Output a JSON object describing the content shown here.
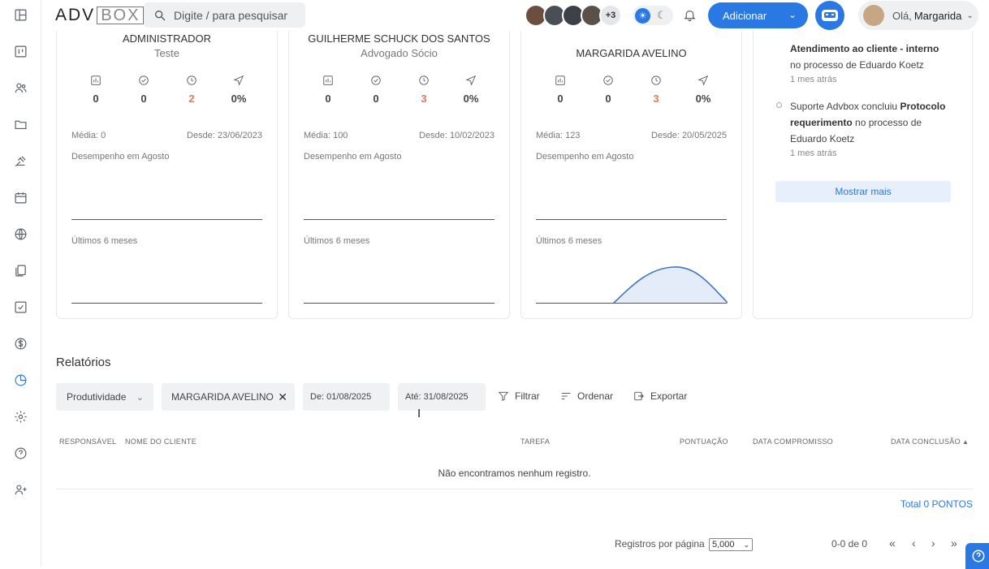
{
  "search": {
    "placeholder": "Digite / para pesquisar"
  },
  "header": {
    "avatars_more": "+3",
    "add_label": "Adicionar",
    "greeting": "Olá,",
    "user_name": "Margarida"
  },
  "cards": [
    {
      "name": "ADMINISTRADOR",
      "role": "Teste",
      "stats": [
        "0",
        "0",
        "2",
        "0%"
      ],
      "media": "Média: 0",
      "since": "Desde: 23/06/2023",
      "performance": "Desempenho em Agosto",
      "last_months": "Últimos 6 meses"
    },
    {
      "name": "GUILHERME SCHUCK DOS SANTOS",
      "role": "Advogado Sócio",
      "stats": [
        "0",
        "0",
        "3",
        "0%"
      ],
      "media": "Média: 100",
      "since": "Desde: 10/02/2023",
      "performance": "Desempenho em Agosto",
      "last_months": "Últimos 6 meses"
    },
    {
      "name": "MARGARIDA AVELINO",
      "role": "",
      "stats": [
        "0",
        "0",
        "3",
        "0%"
      ],
      "media": "Média: 123",
      "since": "Desde: 20/05/2025",
      "performance": "Desempenho em Agosto",
      "last_months": "Últimos 6 meses"
    }
  ],
  "activity": {
    "item1_bold": "Atendimento ao cliente - interno",
    "item1_rest": "no processo de Eduardo Koetz",
    "item1_time": "1 mes atrás",
    "item2_pre": "Suporte Advbox concluiu",
    "item2_bold": "Protocolo requerimento",
    "item2_rest": "no processo de Eduardo Koetz",
    "item2_time": "1 mes atrás",
    "more": "Mostrar mais"
  },
  "reports": {
    "title": "Relatórios",
    "type": "Produtividade",
    "person": "MARGARIDA AVELINO",
    "from": "De: 01/08/2025",
    "to": "Até: 31/08/2025",
    "filter": "Filtrar",
    "order": "Ordenar",
    "export": "Exportar",
    "columns": [
      "RESPONSÁVEL",
      "NOME DO CLIENTE",
      "TAREFA",
      "PONTUAÇÃO",
      "DATA COMPROMISSO",
      "DATA CONCLUSÃO"
    ],
    "empty": "Não encontramos nenhum registro.",
    "total": "Total 0 PONTOS",
    "per_page_label": "Registros por página",
    "per_page": "5,000",
    "range": "0-0 de 0"
  }
}
